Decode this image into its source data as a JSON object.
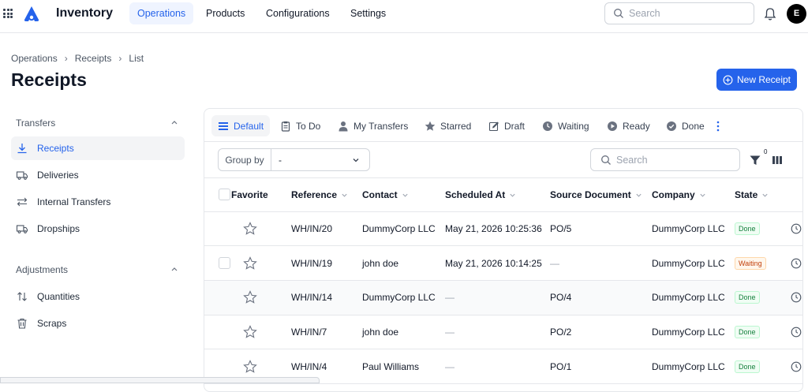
{
  "app": {
    "name": "Inventory",
    "avatar_initial": "E"
  },
  "nav": {
    "items": [
      {
        "label": "Operations",
        "active": true
      },
      {
        "label": "Products"
      },
      {
        "label": "Configurations"
      },
      {
        "label": "Settings"
      }
    ],
    "search_placeholder": "Search"
  },
  "breadcrumb": [
    "Operations",
    "Receipts",
    "List"
  ],
  "page_title": "Receipts",
  "new_button_label": "New Receipt",
  "sidebar": {
    "sections": [
      {
        "title": "Transfers",
        "items": [
          {
            "label": "Receipts",
            "icon": "download-icon",
            "active": true
          },
          {
            "label": "Deliveries",
            "icon": "truck-icon"
          },
          {
            "label": "Internal Transfers",
            "icon": "arrows-icon"
          },
          {
            "label": "Dropships",
            "icon": "truck-icon"
          }
        ]
      },
      {
        "title": "Adjustments",
        "items": [
          {
            "label": "Quantities",
            "icon": "sort-arrows-icon"
          },
          {
            "label": "Scraps",
            "icon": "trash-icon"
          }
        ]
      }
    ]
  },
  "filters": [
    {
      "label": "Default",
      "icon": "list-icon",
      "active": true
    },
    {
      "label": "To Do",
      "icon": "clipboard-icon"
    },
    {
      "label": "My Transfers",
      "icon": "user-icon"
    },
    {
      "label": "Starred",
      "icon": "star-icon"
    },
    {
      "label": "Draft",
      "icon": "pencil-icon"
    },
    {
      "label": "Waiting",
      "icon": "clock-icon"
    },
    {
      "label": "Ready",
      "icon": "play-icon"
    },
    {
      "label": "Done",
      "icon": "check-circle-icon"
    }
  ],
  "toolbar": {
    "group_by_label": "Group by",
    "group_by_value": "-",
    "search_placeholder": "Search",
    "filter_count": "0"
  },
  "table": {
    "columns": [
      "Favorite",
      "Reference",
      "Contact",
      "Scheduled At",
      "Source Document",
      "Company",
      "State"
    ],
    "rows": [
      {
        "reference": "WH/IN/20",
        "contact": "DummyCorp LLC",
        "scheduled": "May 21, 2026 10:25:36",
        "source": "PO/5",
        "company": "DummyCorp LLC",
        "state": "Done"
      },
      {
        "reference": "WH/IN/19",
        "contact": "john doe",
        "scheduled": "May 21, 2026 10:14:25",
        "source": "—",
        "company": "DummyCorp LLC",
        "state": "Waiting"
      },
      {
        "reference": "WH/IN/14",
        "contact": "DummyCorp LLC",
        "scheduled": "—",
        "source": "PO/4",
        "company": "DummyCorp LLC",
        "state": "Done"
      },
      {
        "reference": "WH/IN/7",
        "contact": "john doe",
        "scheduled": "—",
        "source": "PO/2",
        "company": "DummyCorp LLC",
        "state": "Done"
      },
      {
        "reference": "WH/IN/4",
        "contact": "Paul Williams",
        "scheduled": "—",
        "source": "PO/1",
        "company": "DummyCorp LLC",
        "state": "Done"
      }
    ]
  },
  "colors": {
    "accent": "#2563eb",
    "done": "#15803d",
    "waiting": "#c2410c"
  }
}
